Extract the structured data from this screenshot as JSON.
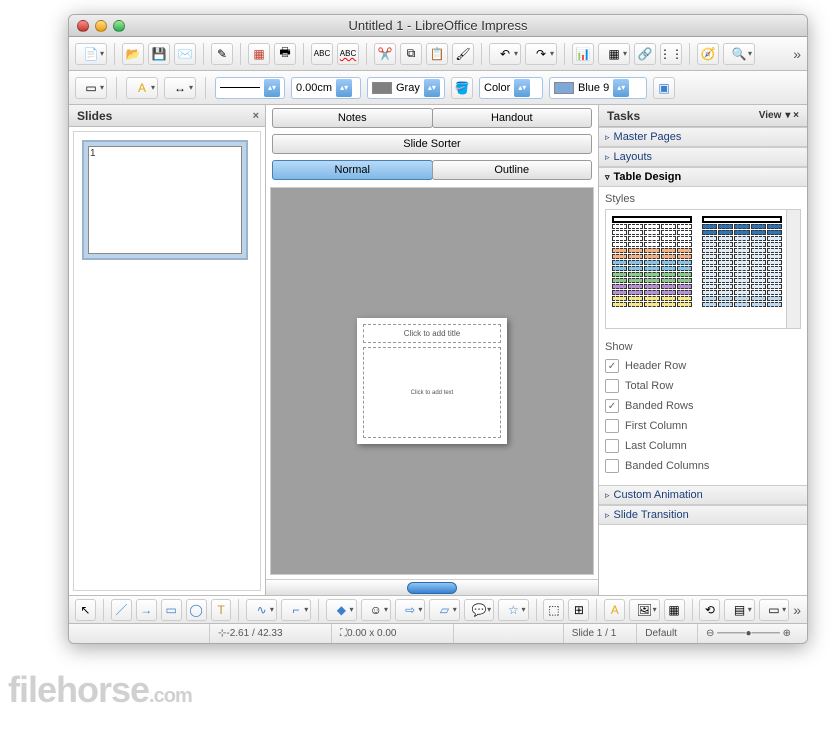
{
  "window": {
    "title": "Untitled 1 - LibreOffice Impress"
  },
  "toolbar2": {
    "width_value": "0.00cm",
    "line_color": {
      "label": "Gray",
      "swatch": "#808080"
    },
    "fill_mode": "Color",
    "fill_color": {
      "label": "Blue 9",
      "swatch": "#7fa8d8"
    }
  },
  "slides_panel": {
    "title": "Slides",
    "slide_number": "1"
  },
  "tabs": {
    "notes": "Notes",
    "handout": "Handout",
    "sorter": "Slide Sorter",
    "normal": "Normal",
    "outline": "Outline"
  },
  "editor": {
    "title_placeholder": "Click to add title",
    "text_placeholder": "Click to add text"
  },
  "tasks": {
    "title": "Tasks",
    "view": "View",
    "sections": {
      "master": "Master Pages",
      "layouts": "Layouts",
      "table": "Table Design",
      "anim": "Custom Animation",
      "trans": "Slide Transition"
    },
    "styles_label": "Styles",
    "show_label": "Show",
    "show": {
      "header_row": "Header Row",
      "total_row": "Total Row",
      "banded_rows": "Banded Rows",
      "first_col": "First Column",
      "last_col": "Last Column",
      "banded_cols": "Banded Columns"
    }
  },
  "status": {
    "coords": "-2.61 / 42.33",
    "size": "0.00 x 0.00",
    "slide": "Slide 1 / 1",
    "default": "Default"
  },
  "watermark": {
    "main": "filehorse",
    "suffix": ".com"
  },
  "style_palettes": [
    [
      "#fff",
      "#fff",
      "#fff",
      "#fff",
      "#f5b183",
      "#f5b183",
      "#86c5e8",
      "#86c5e8",
      "#8dc78d",
      "#8dc78d",
      "#b891d0",
      "#b891d0",
      "#f5e68b",
      "#f5e68b"
    ],
    [
      "#2e74b5",
      "#2e74b5",
      "#deeaf6",
      "#deeaf6",
      "#deeaf6",
      "#deeaf6",
      "#deeaf6",
      "#deeaf6",
      "#deeaf6",
      "#deeaf6",
      "#deeaf6",
      "#deeaf6",
      "#bdd7ee",
      "#bdd7ee"
    ]
  ]
}
